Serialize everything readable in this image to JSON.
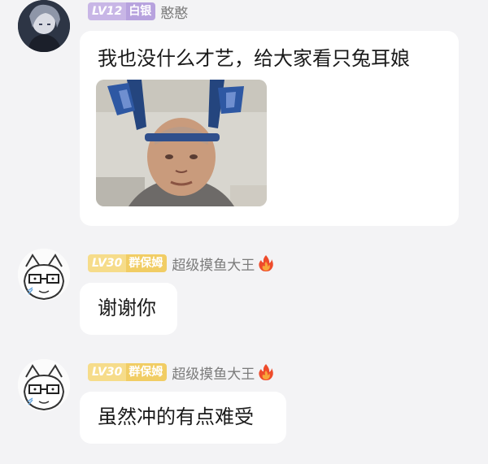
{
  "messages": [
    {
      "level": "LV12",
      "title": "白银",
      "nickname": "憨憨",
      "text": "我也没什么才艺，给大家看只兔耳娘",
      "has_image": true,
      "image_icon": "photo-bunny-ears-man"
    },
    {
      "level": "LV30",
      "title": "群保姆",
      "nickname": "超级摸鱼大王",
      "text": "谢谢你",
      "badge_icon": "fire-icon"
    },
    {
      "level": "LV30",
      "title": "群保姆",
      "nickname": "超级摸鱼大王",
      "text": "虽然冲的有点难受",
      "badge_icon": "fire-icon"
    }
  ],
  "colors": {
    "background": "#f3f3f5",
    "bubble": "#ffffff",
    "lv12_badge": "#b7a2de",
    "lv30_badge": "#f1cd64",
    "nickname": "#7b7b7b"
  }
}
